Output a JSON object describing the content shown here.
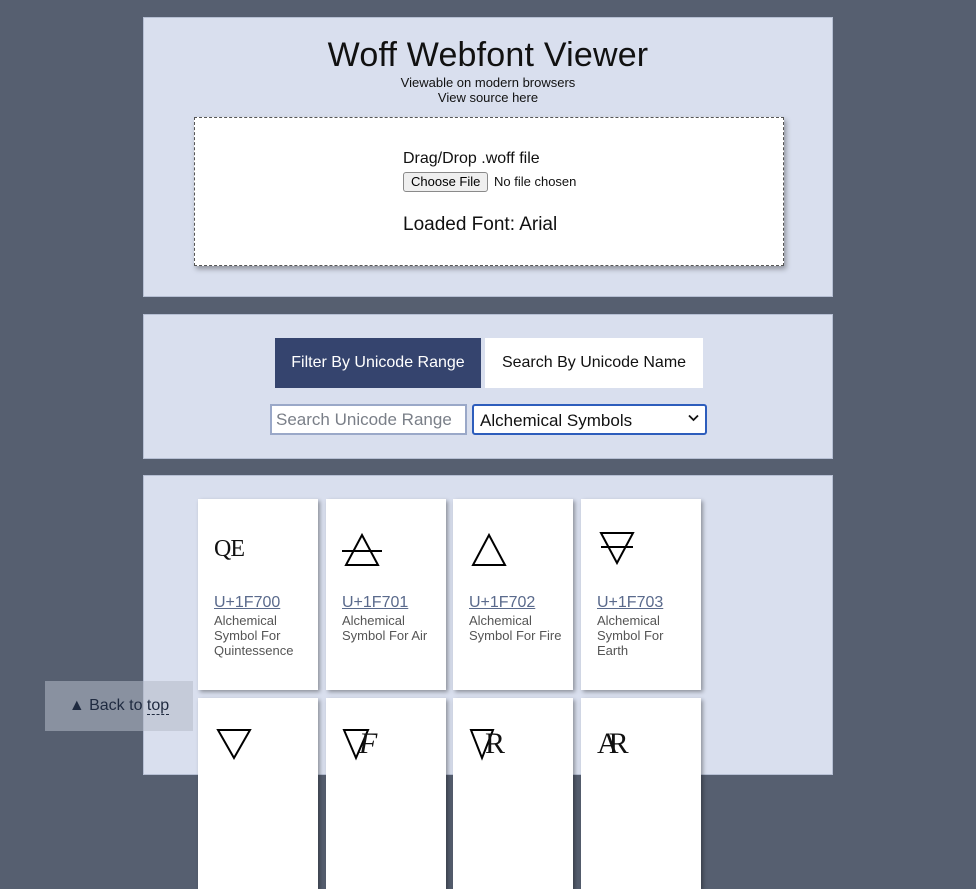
{
  "header": {
    "title": "Woff Webfont Viewer",
    "subtitle": "Viewable on modern browsers",
    "source_link": "View source here"
  },
  "dropzone": {
    "label": "Drag/Drop .woff file",
    "choose_button": "Choose File",
    "file_status": "No file chosen",
    "loaded_font": "Loaded Font: Arial"
  },
  "filter": {
    "tabs": [
      {
        "label": "Filter By Unicode Range",
        "active": true
      },
      {
        "label": "Search By Unicode Name",
        "active": false
      }
    ],
    "search_placeholder": "Search Unicode Range",
    "selected_range": "Alchemical Symbols"
  },
  "glyphs": [
    {
      "code": "U+1F700",
      "name": "Alchemical Symbol For Quintessence",
      "glyph": "QE",
      "icon": "quintessence-icon"
    },
    {
      "code": "U+1F701",
      "name": "Alchemical Symbol For Air",
      "glyph": "",
      "icon": "air-triangle-icon"
    },
    {
      "code": "U+1F702",
      "name": "Alchemical Symbol For Fire",
      "glyph": "",
      "icon": "fire-triangle-icon"
    },
    {
      "code": "U+1F703",
      "name": "Alchemical Symbol For Earth",
      "glyph": "",
      "icon": "earth-triangle-icon"
    },
    {
      "code": "",
      "name": "",
      "glyph": "",
      "icon": "water-triangle-icon"
    },
    {
      "code": "",
      "name": "",
      "glyph": "F",
      "icon": "aquafortis-icon"
    },
    {
      "code": "",
      "name": "",
      "glyph": "R",
      "icon": "aqua-regia-icon"
    },
    {
      "code": "",
      "name": "",
      "glyph": "AR",
      "icon": "aqua-regia-2-icon"
    }
  ],
  "back_to_top": {
    "label_prefix": "▲ Back to ",
    "label_link": "top"
  },
  "colors": {
    "page_background": "#565f70",
    "panel_background": "#d9dfee",
    "active_tab": "#35446e",
    "link": "#5a6a8c"
  }
}
